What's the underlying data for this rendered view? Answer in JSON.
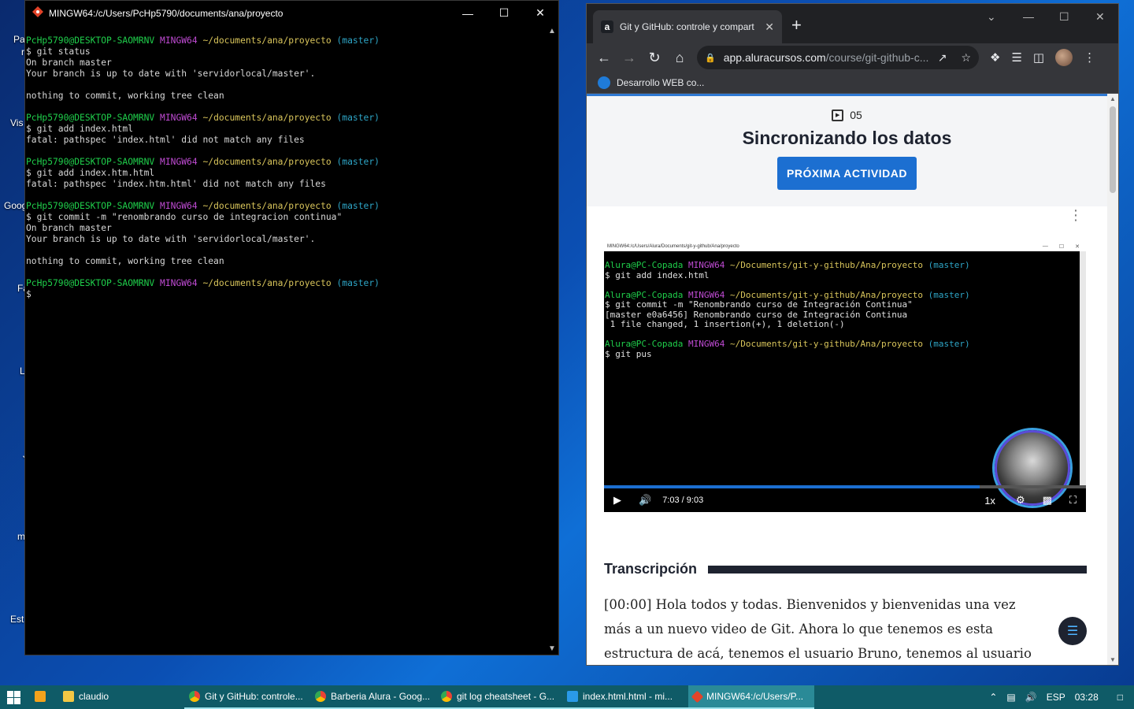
{
  "desktop": {
    "labels": [
      "Pa",
      "r",
      "Vis",
      "Goog",
      "Fa",
      "L",
      "J",
      "m",
      "Est"
    ]
  },
  "terminal": {
    "title": "MINGW64:/c/Users/PcHp5790/documents/ana/proyecto",
    "prompt": {
      "user": "PcHp5790@DESKTOP-SAOMRNV",
      "env": "MINGW64",
      "path": "~/documents/ana/proyecto",
      "branch": "(master)"
    },
    "blocks": [
      {
        "cmd": "$ git status",
        "out": [
          "On branch master",
          "Your branch is up to date with 'servidorlocal/master'.",
          "",
          "nothing to commit, working tree clean"
        ]
      },
      {
        "cmd": "$ git add index.html",
        "out": [
          "fatal: pathspec 'index.html' did not match any files"
        ]
      },
      {
        "cmd": "$ git add index.htm.html",
        "out": [
          "fatal: pathspec 'index.htm.html' did not match any files"
        ]
      },
      {
        "cmd": "$ git commit -m \"renombrando curso de integracion continua\"",
        "out": [
          "On branch master",
          "Your branch is up to date with 'servidorlocal/master'.",
          "",
          "nothing to commit, working tree clean"
        ]
      },
      {
        "cmd": "$",
        "out": []
      }
    ]
  },
  "browser": {
    "tab_title": "Git y GitHub: controle y compart",
    "tab_favicon": "a",
    "url_host": "app.aluracursos.com",
    "url_path": "/course/git-github-c...",
    "bookmark": "Desarrollo WEB co...",
    "lesson_number": "05",
    "lesson_title": "Sincronizando los datos",
    "next_button": "PRÓXIMA ACTIVIDAD",
    "video": {
      "window_title": "MINGW64:/c/Users/Alura/Documents/git-y-github/Ana/proyecto",
      "prompt": {
        "user": "Alura@PC-Copada",
        "env": "MINGW64",
        "path": "~/Documents/git-y-github/Ana/proyecto",
        "branch": "(master)"
      },
      "blocks": [
        {
          "cmd": "$ git add index.html",
          "out": []
        },
        {
          "cmd": "$ git commit -m \"Renombrando curso de Integración Continua\"",
          "out": [
            "[master e0a6456] Renombrando curso de Integración Continua",
            " 1 file changed, 1 insertion(+), 1 deletion(-)"
          ]
        },
        {
          "cmd": "$ git pus",
          "out": []
        }
      ],
      "current_time": "7:03",
      "separator": "/",
      "duration": "9:03",
      "progress_fraction": 0.78,
      "speed": "1x"
    },
    "transcript_heading": "Transcripción",
    "transcript_text": "[00:00] Hola todos y todas. Bienvenidos y bienvenidas una vez más a un nuevo video de Git. Ahora lo que tenemos es esta estructura de acá, tenemos el usuario Bruno, tenemos al usuario Ana y tenemos un"
  },
  "taskbar": {
    "items": [
      {
        "label": "claudio",
        "icon": "folder-icon"
      },
      {
        "label": "Git y GitHub: controle...",
        "icon": "chrome-icon"
      },
      {
        "label": "Barberia Alura - Goog...",
        "icon": "chrome-icon"
      },
      {
        "label": "git log cheatsheet - G...",
        "icon": "chrome-icon"
      },
      {
        "label": "index.html.html - mi...",
        "icon": "vscode-icon"
      },
      {
        "label": "MINGW64:/c/Users/P...",
        "icon": "git-bash-icon"
      }
    ],
    "language": "ESP",
    "clock": "03:28"
  },
  "colors": {
    "prompt_user": "#1fcf4b",
    "prompt_env": "#c04bd4",
    "prompt_path": "#d9c55b",
    "prompt_branch": "#2ea6c7",
    "accent": "#1c6fd1",
    "taskbar": "#0f5b67"
  }
}
